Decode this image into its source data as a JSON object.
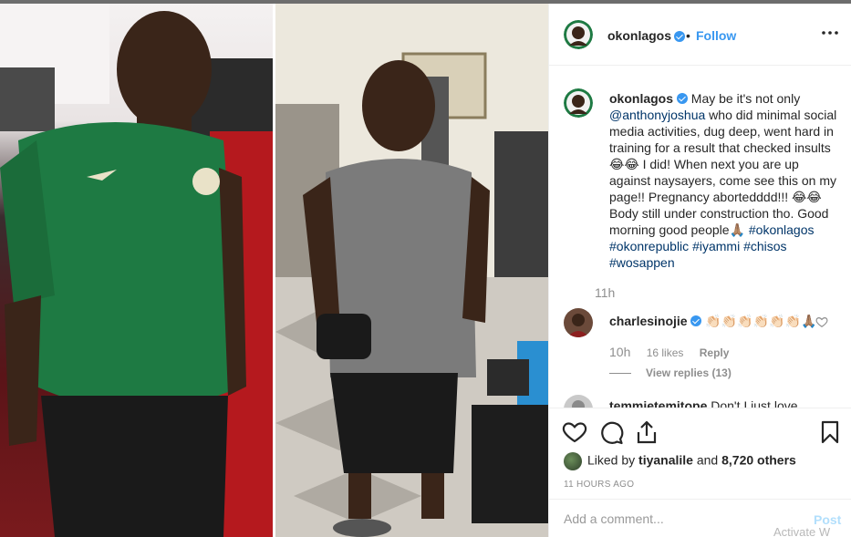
{
  "post": {
    "username": "okonlagos",
    "follow_label": "Follow",
    "separator": "•"
  },
  "caption": {
    "username": "okonlagos",
    "segments": [
      {
        "text": "May be it's not only ",
        "link": false
      },
      {
        "text": "@anthonyjoshua",
        "link": true
      },
      {
        "text": " who did minimal social media activities, dug deep, went hard in training for a result that checked insults😂😂 I did! When next you are up against naysayers, come see this on my page!! Pregnancy abortedddd!!! 😂😂 Body still under construction tho. Good morning good people🙏🏽 ",
        "link": false
      },
      {
        "text": "#okonlagos",
        "link": true
      },
      {
        "text": " ",
        "link": false
      },
      {
        "text": "#okonrepublic",
        "link": true
      },
      {
        "text": " ",
        "link": false
      },
      {
        "text": "#iyammi",
        "link": true
      },
      {
        "text": " ",
        "link": false
      },
      {
        "text": "#chisos",
        "link": true
      },
      {
        "text": " ",
        "link": false
      },
      {
        "text": "#wosappen",
        "link": true
      }
    ],
    "time": "11h"
  },
  "comments": [
    {
      "username": "charlesinojie",
      "text": "👏🏻👏🏻👏🏻👏🏻👏🏻👏🏻🙏🏽",
      "time": "10h",
      "likes": "16 likes",
      "reply_label": "Reply",
      "view_replies": "View replies (13)"
    },
    {
      "username": "temmietemitope",
      "text": "Don't I just love"
    }
  ],
  "likes": {
    "prefix": "Liked by ",
    "liker": "tiyanalile",
    "middle": " and ",
    "count": "8,720 others"
  },
  "date": "11 HOURS AGO",
  "composer": {
    "placeholder": "Add a comment...",
    "post_label": "Post"
  },
  "watermark": "Activate W",
  "icons": {
    "more": "more-horizontal-icon",
    "like": "heart-icon",
    "comment": "comment-bubble-icon",
    "share": "share-icon",
    "save": "bookmark-icon",
    "verified": "verified-badge-icon"
  },
  "colors": {
    "accent": "#3897f0",
    "link": "#003569",
    "muted": "#8e8e8e",
    "post_disabled": "#b2dffc"
  }
}
